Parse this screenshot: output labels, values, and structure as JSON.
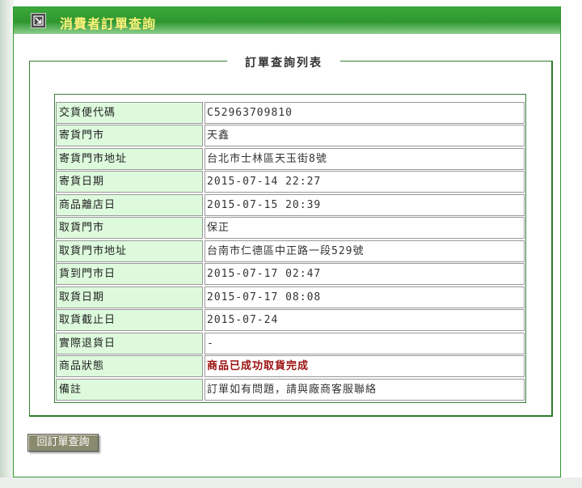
{
  "header": {
    "title": "消費者訂單查詢",
    "icon": "arrow-down-right-icon"
  },
  "section": {
    "legend": "訂單查詢列表"
  },
  "order": {
    "rows": [
      {
        "label": "交貨便代碼",
        "value": "C52963709810"
      },
      {
        "label": "寄貨門市",
        "value": "天鑫"
      },
      {
        "label": "寄貨門市地址",
        "value": "台北市士林區天玉街8號"
      },
      {
        "label": "寄貨日期",
        "value": "2015-07-14 22:27"
      },
      {
        "label": "商品離店日",
        "value": "2015-07-15 20:39"
      },
      {
        "label": "取貨門市",
        "value": "保正"
      },
      {
        "label": "取貨門市地址",
        "value": "台南市仁德區中正路一段529號"
      },
      {
        "label": "貨到門市日",
        "value": "2015-07-17 02:47"
      },
      {
        "label": "取貨日期",
        "value": "2015-07-17 08:08"
      },
      {
        "label": "取貨截止日",
        "value": "2015-07-24"
      },
      {
        "label": "實際退貨日",
        "value": "-"
      },
      {
        "label": "商品狀態",
        "value": "商品已成功取貨完成"
      },
      {
        "label": "備註",
        "value": "訂單如有問題，請與廠商客服聯絡"
      }
    ]
  },
  "actions": {
    "back_label": "回訂單查詢"
  },
  "colors": {
    "header_green": "#2f962f",
    "label_bg": "#ddfadd",
    "status_red": "#9c0f0f",
    "title_yellow": "#fff37a"
  }
}
